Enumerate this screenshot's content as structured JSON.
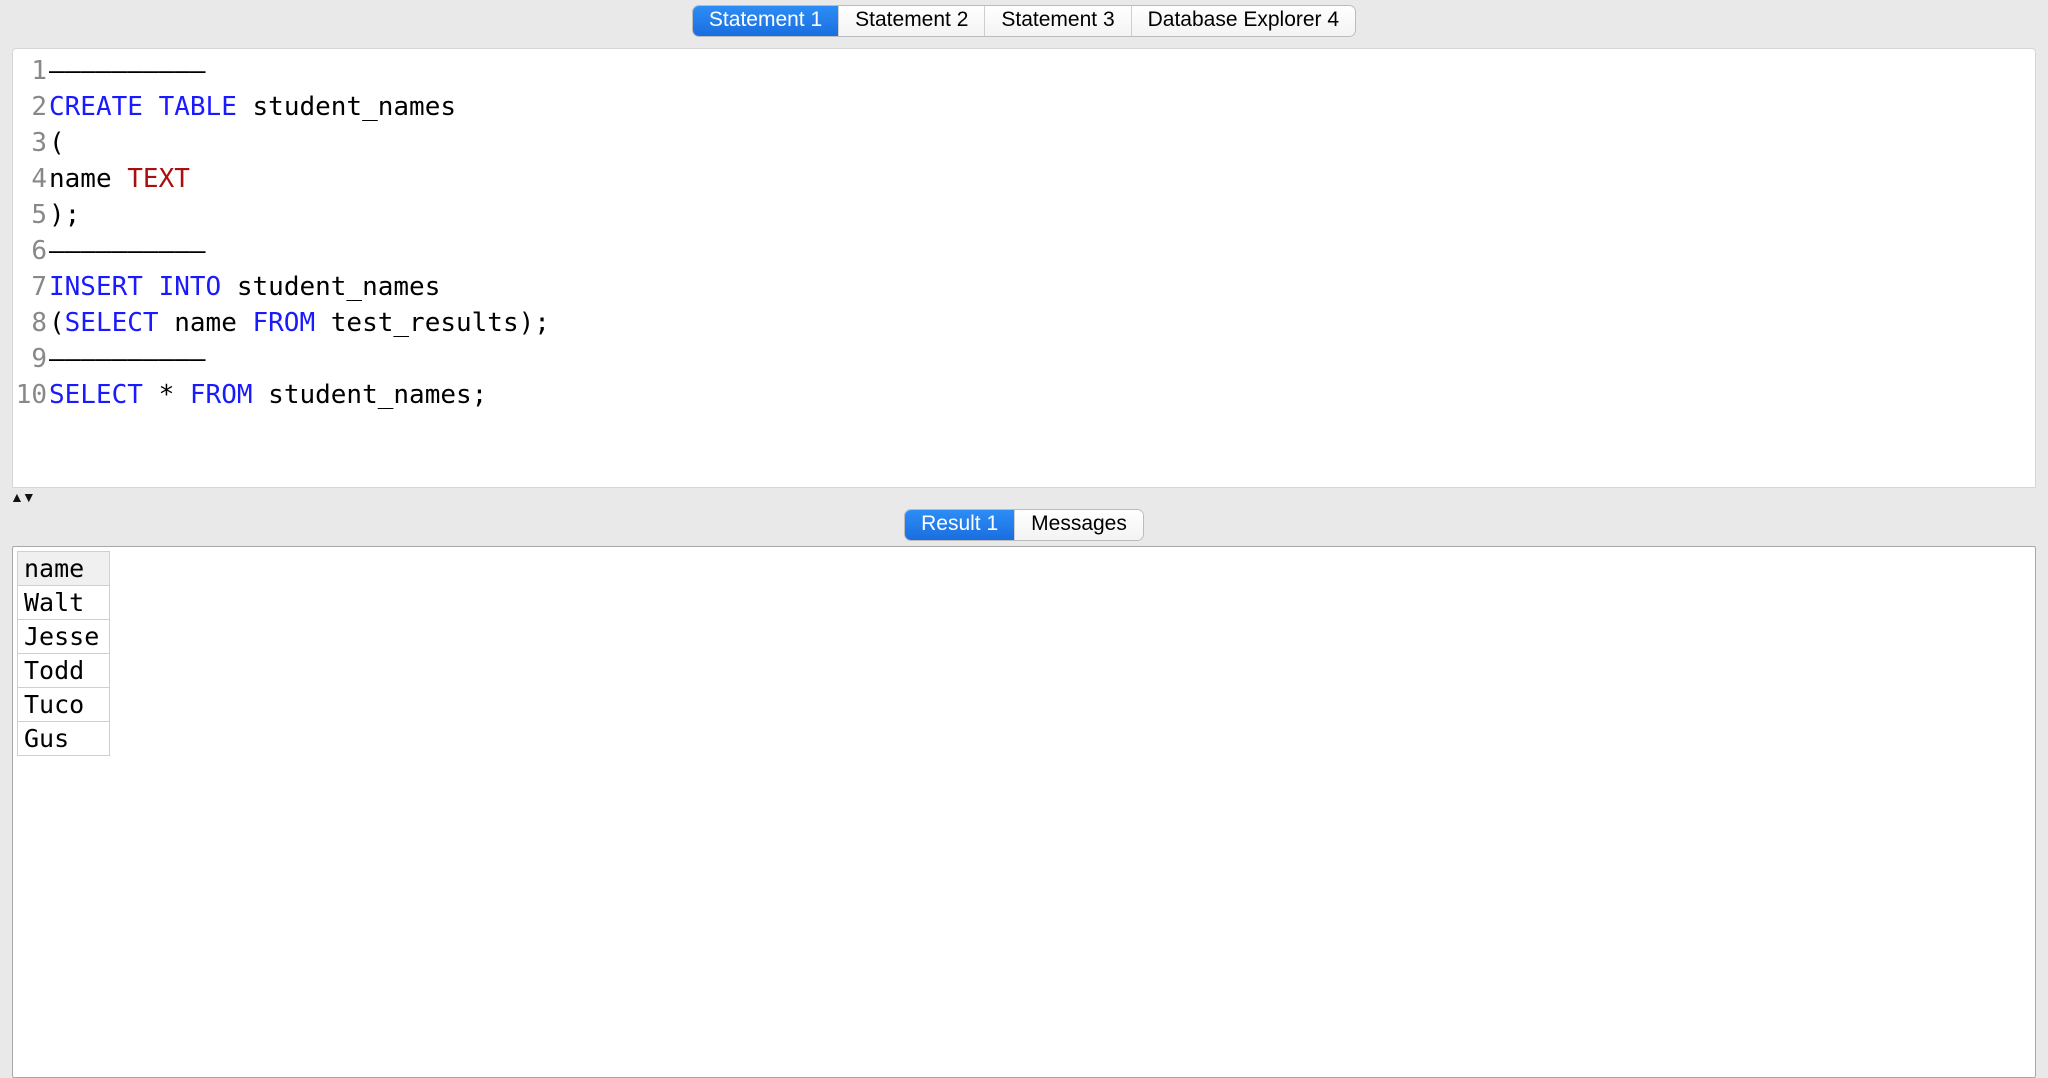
{
  "top_tabs": {
    "active_index": 0,
    "items": [
      "Statement 1",
      "Statement 2",
      "Statement 3",
      "Database Explorer 4"
    ]
  },
  "editor": {
    "line_count": 10,
    "lines": [
      [
        {
          "t": "plain",
          "v": "——————————"
        }
      ],
      [
        {
          "t": "kw",
          "v": "CREATE"
        },
        {
          "t": "plain",
          "v": " "
        },
        {
          "t": "kw",
          "v": "TABLE"
        },
        {
          "t": "plain",
          "v": " student_names"
        }
      ],
      [
        {
          "t": "plain",
          "v": "("
        }
      ],
      [
        {
          "t": "plain",
          "v": "name "
        },
        {
          "t": "type",
          "v": "TEXT"
        }
      ],
      [
        {
          "t": "plain",
          "v": ");"
        }
      ],
      [
        {
          "t": "plain",
          "v": "——————————"
        }
      ],
      [
        {
          "t": "kw",
          "v": "INSERT"
        },
        {
          "t": "plain",
          "v": " "
        },
        {
          "t": "kw",
          "v": "INTO"
        },
        {
          "t": "plain",
          "v": " student_names"
        }
      ],
      [
        {
          "t": "plain",
          "v": "("
        },
        {
          "t": "kw",
          "v": "SELECT"
        },
        {
          "t": "plain",
          "v": " name "
        },
        {
          "t": "kw",
          "v": "FROM"
        },
        {
          "t": "plain",
          "v": " test_results);"
        }
      ],
      [
        {
          "t": "plain",
          "v": "——————————"
        }
      ],
      [
        {
          "t": "kw",
          "v": "SELECT"
        },
        {
          "t": "plain",
          "v": " * "
        },
        {
          "t": "kw",
          "v": "FROM"
        },
        {
          "t": "plain",
          "v": " student_names;"
        }
      ]
    ]
  },
  "bottom_tabs": {
    "active_index": 0,
    "items": [
      "Result 1",
      "Messages"
    ]
  },
  "result": {
    "columns": [
      "name"
    ],
    "rows": [
      [
        "Walt"
      ],
      [
        "Jesse"
      ],
      [
        "Todd"
      ],
      [
        "Tuco"
      ],
      [
        "Gus"
      ]
    ]
  }
}
